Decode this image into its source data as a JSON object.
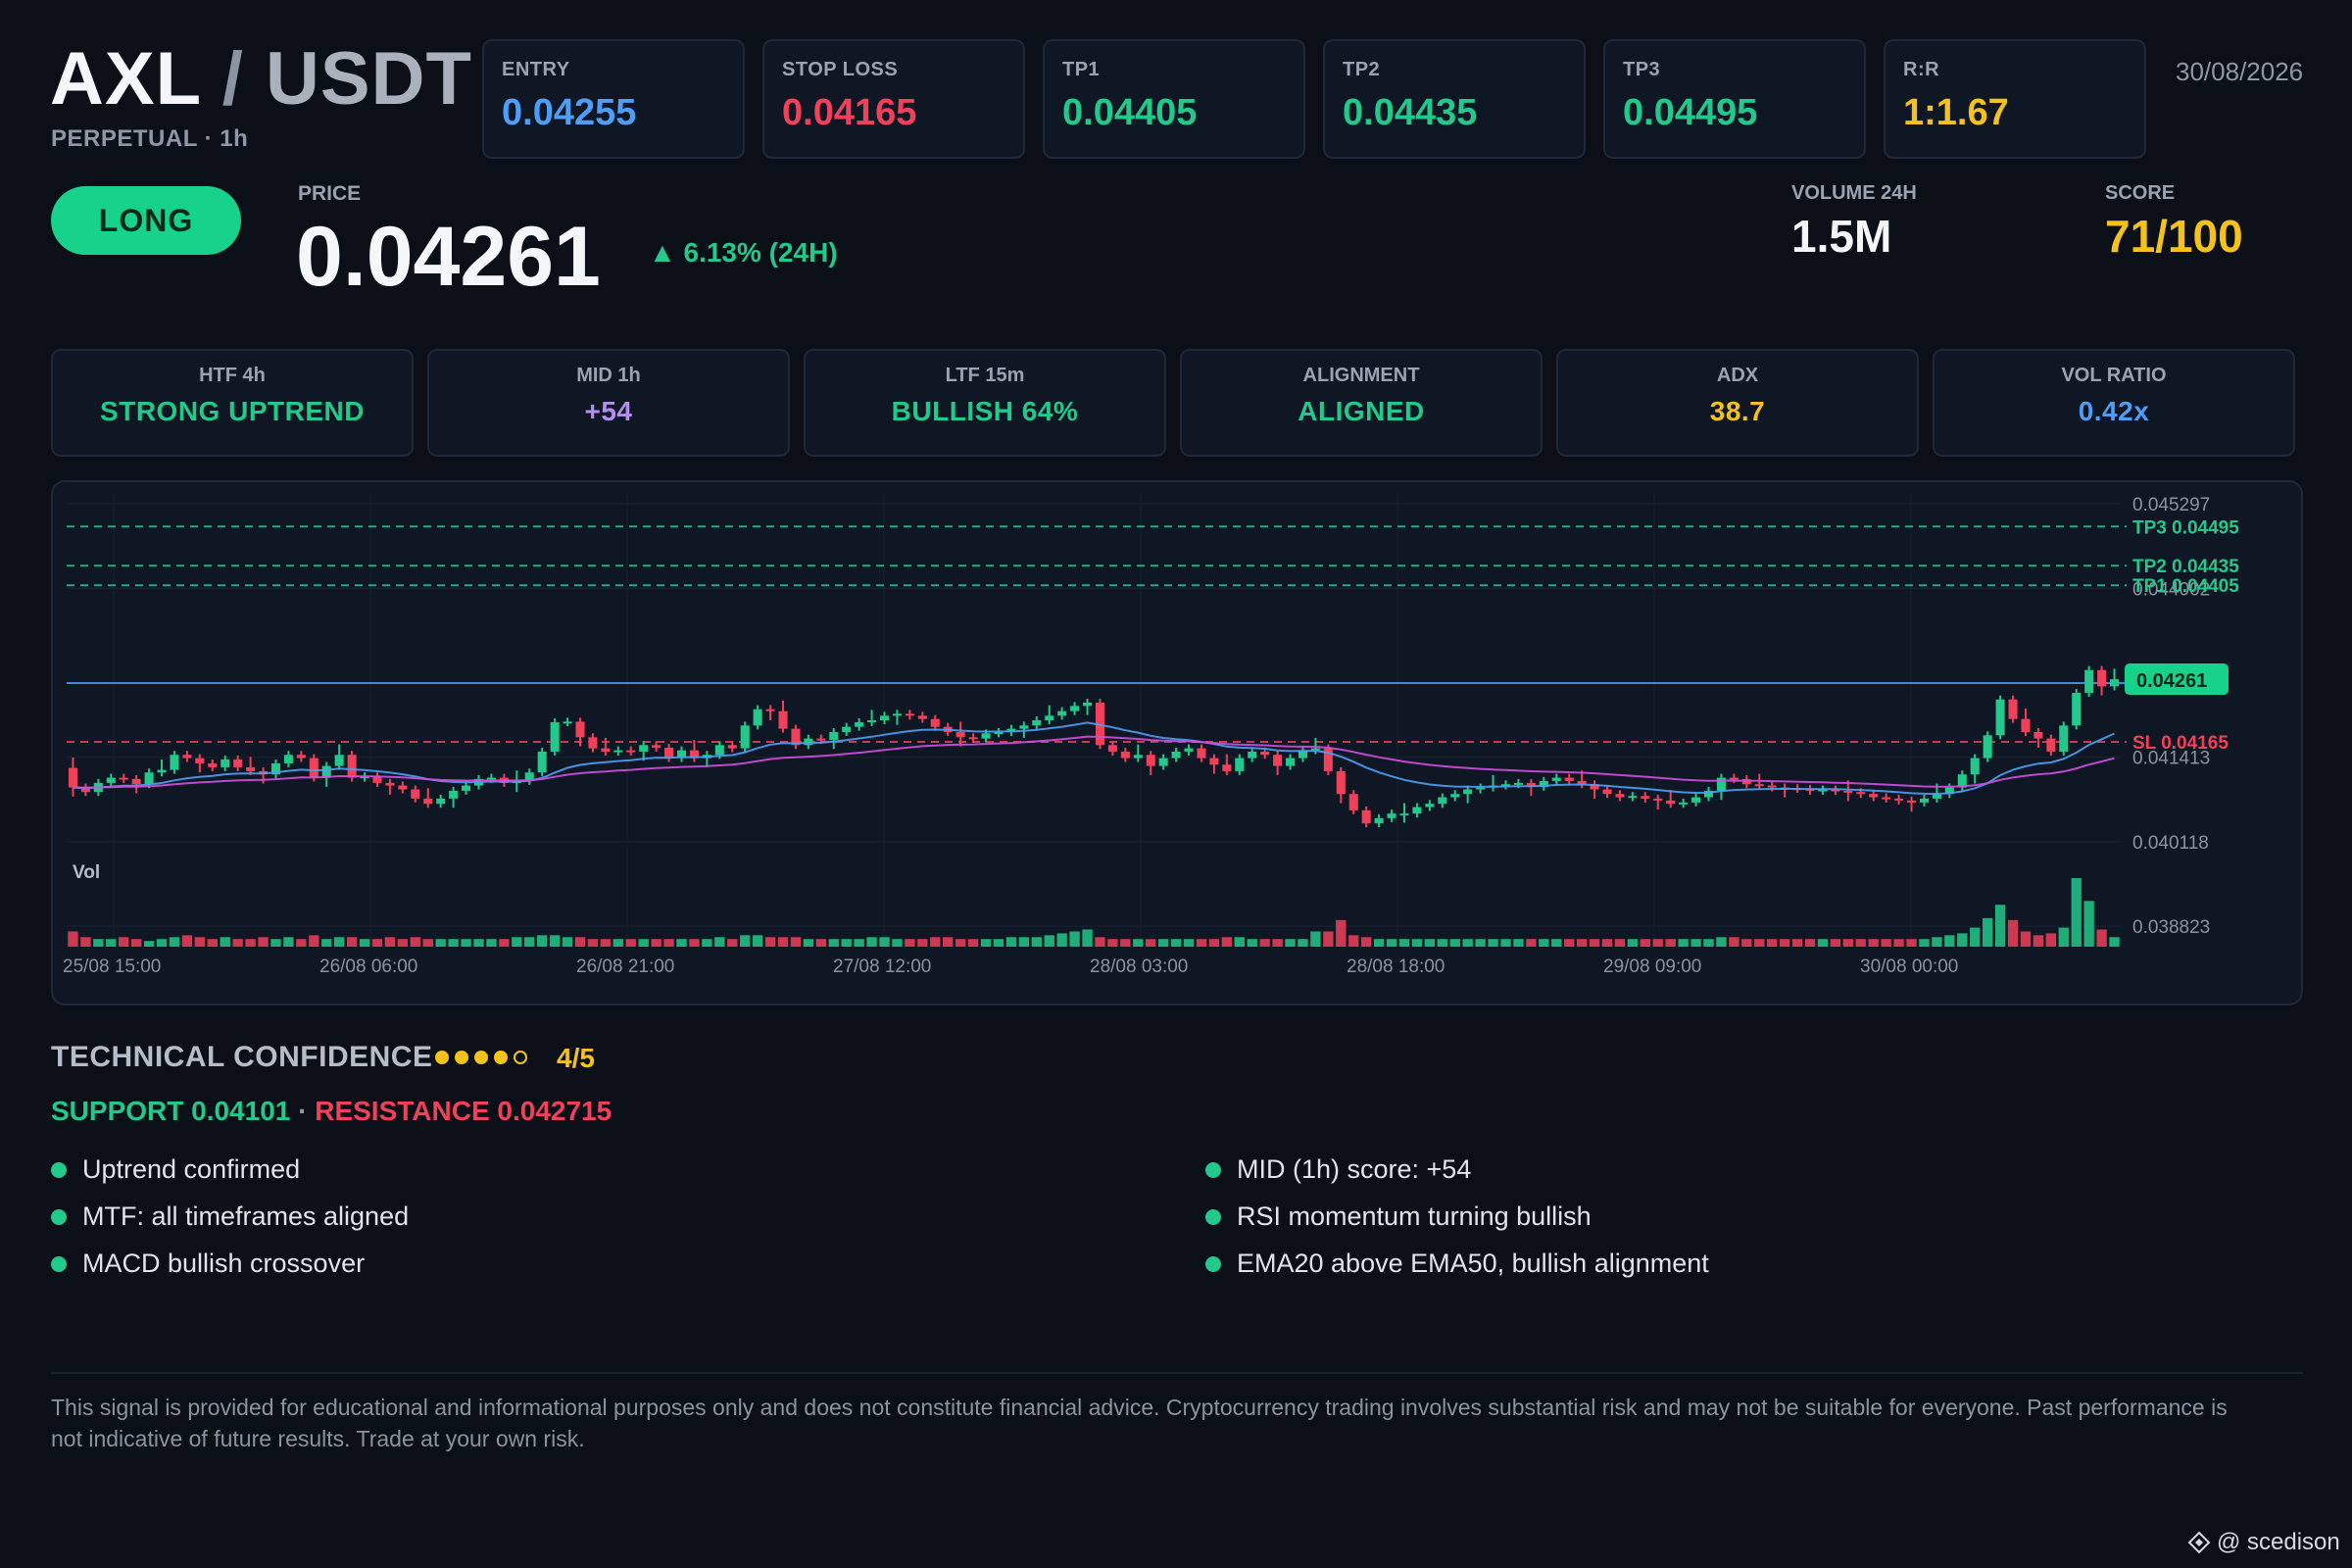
{
  "header": {
    "base": "AXL",
    "separator": "/",
    "quote": "USDT",
    "subtitle": "PERPETUAL · 1h",
    "date": "30/08/2026"
  },
  "levels": [
    {
      "label": "ENTRY",
      "value": "0.04255",
      "color": "#4d9ef6"
    },
    {
      "label": "STOP LOSS",
      "value": "0.04165",
      "color": "#f0405a"
    },
    {
      "label": "TP1",
      "value": "0.04405",
      "color": "#22c98a"
    },
    {
      "label": "TP2",
      "value": "0.04435",
      "color": "#22c98a"
    },
    {
      "label": "TP3",
      "value": "0.04495",
      "color": "#22c98a"
    },
    {
      "label": "R:R",
      "value": "1:1.67",
      "color": "#f5c21b"
    }
  ],
  "signal": {
    "direction": "LONG",
    "price_label": "PRICE",
    "price": "0.04261",
    "change": "▲ 6.13% (24H)",
    "volume_label": "VOLUME 24H",
    "volume": "1.5M",
    "score_label": "SCORE",
    "score": "71/100"
  },
  "indicators": [
    {
      "label": "HTF 4h",
      "value": "STRONG UPTREND",
      "color": "#22c98a"
    },
    {
      "label": "MID 1h",
      "value": "+54",
      "color": "#b58cf0"
    },
    {
      "label": "LTF 15m",
      "value": "BULLISH 64%",
      "color": "#22c98a"
    },
    {
      "label": "ALIGNMENT",
      "value": "ALIGNED",
      "color": "#22c98a"
    },
    {
      "label": "ADX",
      "value": "38.7",
      "color": "#f5c21b"
    },
    {
      "label": "VOL RATIO",
      "value": "0.42x",
      "color": "#4d9ef6"
    }
  ],
  "chart_data": {
    "type": "candlestick",
    "ylim": [
      0.03875,
      0.04545
    ],
    "y_ticks": [
      "0.045297",
      "0.044002",
      "0.041413",
      "0.040118",
      "0.038823"
    ],
    "x_ticks": [
      "25/08 15:00",
      "26/08 06:00",
      "26/08 21:00",
      "27/08 12:00",
      "28/08 03:00",
      "28/08 18:00",
      "29/08 09:00",
      "30/08 00:00"
    ],
    "volume_label": "Vol",
    "levels": [
      {
        "name": "TP3 0.04495",
        "value": 0.04495,
        "color": "#22c98a"
      },
      {
        "name": "TP2 0.04435",
        "value": 0.04435,
        "color": "#22c98a"
      },
      {
        "name": "TP1 0.04405",
        "value": 0.04405,
        "color": "#22c98a"
      },
      {
        "name": "0.04255",
        "value": 0.04255,
        "color": "#4d9ef6"
      },
      {
        "name": "SL 0.04165",
        "value": 0.04165,
        "color": "#f0405a"
      }
    ],
    "current_price": {
      "label": "0.04261",
      "value": 0.04261
    },
    "ema20_color": "#4d9ef6",
    "ema50_color": "#d24fe0",
    "up_color": "#22c98a",
    "down_color": "#f0405a",
    "close": [
      0.04095,
      0.04088,
      0.04102,
      0.0411,
      0.04108,
      0.041,
      0.04118,
      0.04122,
      0.04145,
      0.0414,
      0.04132,
      0.04126,
      0.04138,
      0.04126,
      0.0412,
      0.04115,
      0.04132,
      0.04145,
      0.0414,
      0.0411,
      0.04128,
      0.04145,
      0.0411,
      0.04112,
      0.04102,
      0.04098,
      0.04092,
      0.04078,
      0.0407,
      0.04078,
      0.0409,
      0.04098,
      0.04108,
      0.0411,
      0.04102,
      0.04105,
      0.04118,
      0.0415,
      0.04195,
      0.04196,
      0.04172,
      0.04155,
      0.0415,
      0.04152,
      0.0415,
      0.0416,
      0.04156,
      0.0414,
      0.04152,
      0.0414,
      0.04145,
      0.0416,
      0.04155,
      0.0419,
      0.04215,
      0.04212,
      0.04185,
      0.0416,
      0.0417,
      0.04168,
      0.0418,
      0.04188,
      0.04195,
      0.04198,
      0.04205,
      0.04208,
      0.04205,
      0.042,
      0.04188,
      0.0418,
      0.04172,
      0.0417,
      0.04178,
      0.0418,
      0.04185,
      0.0419,
      0.04198,
      0.04205,
      0.04212,
      0.0422,
      0.04225,
      0.0416,
      0.0415,
      0.0414,
      0.04145,
      0.04128,
      0.0414,
      0.0415,
      0.04155,
      0.0414,
      0.0413,
      0.0412,
      0.0414,
      0.0415,
      0.04145,
      0.04128,
      0.0414,
      0.04152,
      0.04155,
      0.0412,
      0.04085,
      0.0406,
      0.0404,
      0.04048,
      0.04055,
      0.04055,
      0.04065,
      0.0407,
      0.0408,
      0.04085,
      0.04092,
      0.04095,
      0.04098,
      0.041,
      0.04102,
      0.04096,
      0.04105,
      0.0411,
      0.04105,
      0.041,
      0.04092,
      0.04085,
      0.0408,
      0.04082,
      0.04078,
      0.04075,
      0.0407,
      0.04072,
      0.0408,
      0.0409,
      0.0411,
      0.04108,
      0.041,
      0.04098,
      0.04095,
      0.04094,
      0.04093,
      0.0409,
      0.04092,
      0.0409,
      0.04088,
      0.04085,
      0.0408,
      0.04078,
      0.04075,
      0.04072,
      0.04078,
      0.04085,
      0.04095,
      0.04115,
      0.0414,
      0.04175,
      0.0423,
      0.042,
      0.0418,
      0.0417,
      0.0415,
      0.0419,
      0.0424,
      0.04275,
      0.0425,
      0.04261
    ],
    "volume": [
      8,
      5,
      4,
      4,
      5,
      4,
      3,
      4,
      5,
      6,
      5,
      4,
      5,
      4,
      4,
      5,
      4,
      5,
      4,
      6,
      4,
      5,
      5,
      4,
      4,
      5,
      4,
      5,
      4,
      4,
      4,
      4,
      4,
      4,
      4,
      5,
      5,
      6,
      6,
      5,
      5,
      4,
      4,
      4,
      4,
      4,
      4,
      4,
      4,
      4,
      4,
      5,
      4,
      6,
      6,
      5,
      5,
      5,
      4,
      4,
      4,
      4,
      4,
      5,
      5,
      4,
      4,
      4,
      5,
      5,
      4,
      4,
      4,
      4,
      5,
      5,
      5,
      6,
      7,
      8,
      9,
      5,
      4,
      4,
      4,
      4,
      4,
      4,
      4,
      4,
      4,
      5,
      5,
      4,
      4,
      4,
      4,
      4,
      8,
      8,
      14,
      6,
      5,
      4,
      4,
      4,
      4,
      4,
      4,
      4,
      4,
      4,
      4,
      4,
      4,
      4,
      4,
      4,
      4,
      4,
      4,
      4,
      4,
      4,
      4,
      4,
      4,
      4,
      4,
      4,
      5,
      5,
      4,
      4,
      4,
      4,
      4,
      4,
      4,
      4,
      4,
      4,
      4,
      4,
      4,
      4,
      4,
      5,
      6,
      7,
      10,
      15,
      22,
      14,
      8,
      6,
      7,
      10,
      36,
      24,
      9,
      5
    ]
  },
  "technical": {
    "title": "TECHNICAL CONFIDENCE",
    "dots_filled": 4,
    "dots_total": 5,
    "score": "4/5",
    "support": "SUPPORT 0.04101",
    "separator": "·",
    "resistance": "RESISTANCE 0.042715",
    "reasons_left": [
      "Uptrend confirmed",
      "MTF: all timeframes aligned",
      "MACD bullish crossover"
    ],
    "reasons_right": [
      "MID (1h) score: +54",
      "RSI momentum turning bullish",
      "EMA20 above EMA50, bullish alignment"
    ]
  },
  "disclaimer": "This signal is provided for educational and informational purposes only and does not constitute financial advice. Cryptocurrency trading involves substantial risk and may not be suitable for everyone. Past performance is not indicative of future results. Trade at your own risk.",
  "watermark": "@ scedison"
}
